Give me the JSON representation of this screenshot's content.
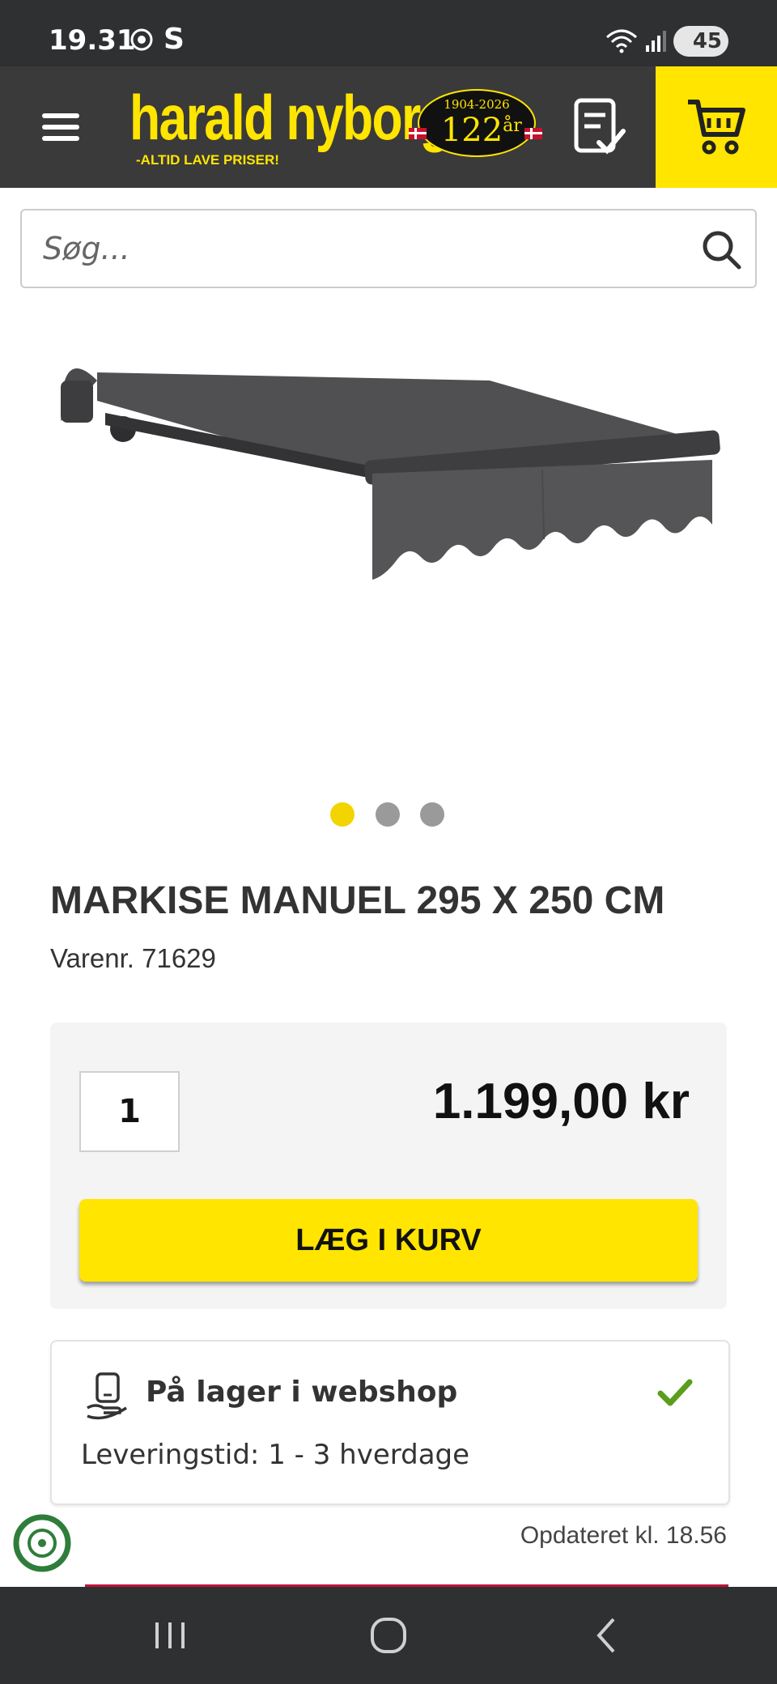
{
  "status_bar": {
    "time": "19.31",
    "carrier_letter": "S",
    "battery": "45"
  },
  "header": {
    "logo_text": "harald nyborg",
    "logo_tagline": "-ALTID LAVE PRISER!",
    "badge_years": "1904-2026",
    "badge_anniversary": "122",
    "badge_suffix": "år"
  },
  "search": {
    "placeholder": "Søg..."
  },
  "product": {
    "title": "MARKISE MANUEL 295 X 250 CM",
    "sku": "Varenr. 71629",
    "carousel_count": 3,
    "carousel_active": 1
  },
  "purchase": {
    "quantity": "1",
    "price": "1.199,00 kr",
    "add_to_cart_label": "LÆG I KURV"
  },
  "stock": {
    "title": "På lager i webshop",
    "delivery": "Leveringstid: 1 - 3 hverdage",
    "updated": "Opdateret kl. 18.56"
  },
  "colors": {
    "brand_yellow": "#ffe500",
    "header_dark": "#3a3a3a",
    "status_dark": "#2f3032",
    "check_green": "#5a9e1c",
    "accent_red": "#c0123a"
  },
  "icons": [
    "menu-icon",
    "checklist-icon",
    "cart-icon",
    "search-icon",
    "stock-pickup-icon",
    "checkmark-icon",
    "eco-icon"
  ]
}
